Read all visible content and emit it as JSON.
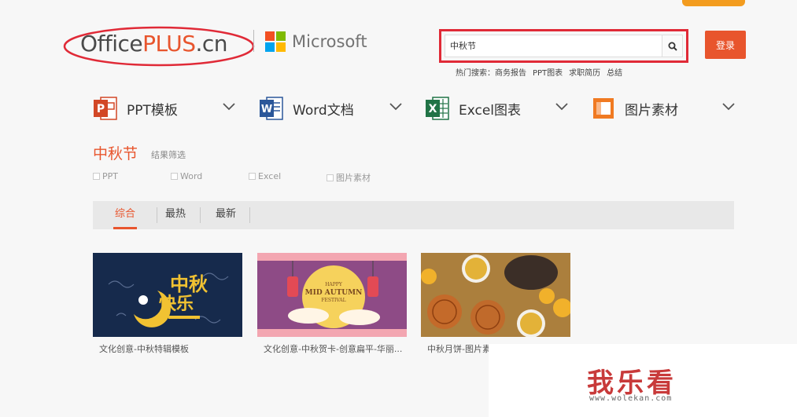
{
  "logo": {
    "text_prefix": "Office",
    "text_plus": "PLUS",
    "text_suffix": ".cn"
  },
  "partner": {
    "name": "Microsoft"
  },
  "search": {
    "value": "中秋节"
  },
  "hot": {
    "label": "热门搜索：",
    "items": [
      "商务报告",
      "PPT图表",
      "求职简历",
      "总结"
    ]
  },
  "login": {
    "label": "登录"
  },
  "categories": [
    {
      "label": "PPT模板",
      "icon": "ppt-icon",
      "color": "#d24726"
    },
    {
      "label": "Word文档",
      "icon": "word-icon",
      "color": "#2b579a"
    },
    {
      "label": "Excel图表",
      "icon": "excel-icon",
      "color": "#217346"
    },
    {
      "label": "图片素材",
      "icon": "image-icon",
      "color": "#f07a22"
    }
  ],
  "results": {
    "title": "中秋节",
    "filter_label": "结果筛选",
    "filters": [
      "PPT",
      "Word",
      "Excel",
      "图片素材"
    ]
  },
  "tabs": [
    {
      "label": "综合",
      "active": true
    },
    {
      "label": "最热",
      "active": false
    },
    {
      "label": "最新",
      "active": false
    }
  ],
  "cards": [
    {
      "title": "文化创意-中秋特辑模板",
      "art_text": [
        "中秋",
        "快乐"
      ]
    },
    {
      "title": "文化创意-中秋贺卡-创意扁平-华丽...",
      "art_text": [
        "HAPPY",
        "MID AUTUMN",
        "FESTIVAL"
      ]
    },
    {
      "title": "中秋月饼-图片素"
    }
  ],
  "watermark": {
    "text": "我乐看",
    "url": "www.wolekan.com"
  },
  "colors": {
    "accent": "#e8552d",
    "search_highlight": "#e02a37"
  }
}
